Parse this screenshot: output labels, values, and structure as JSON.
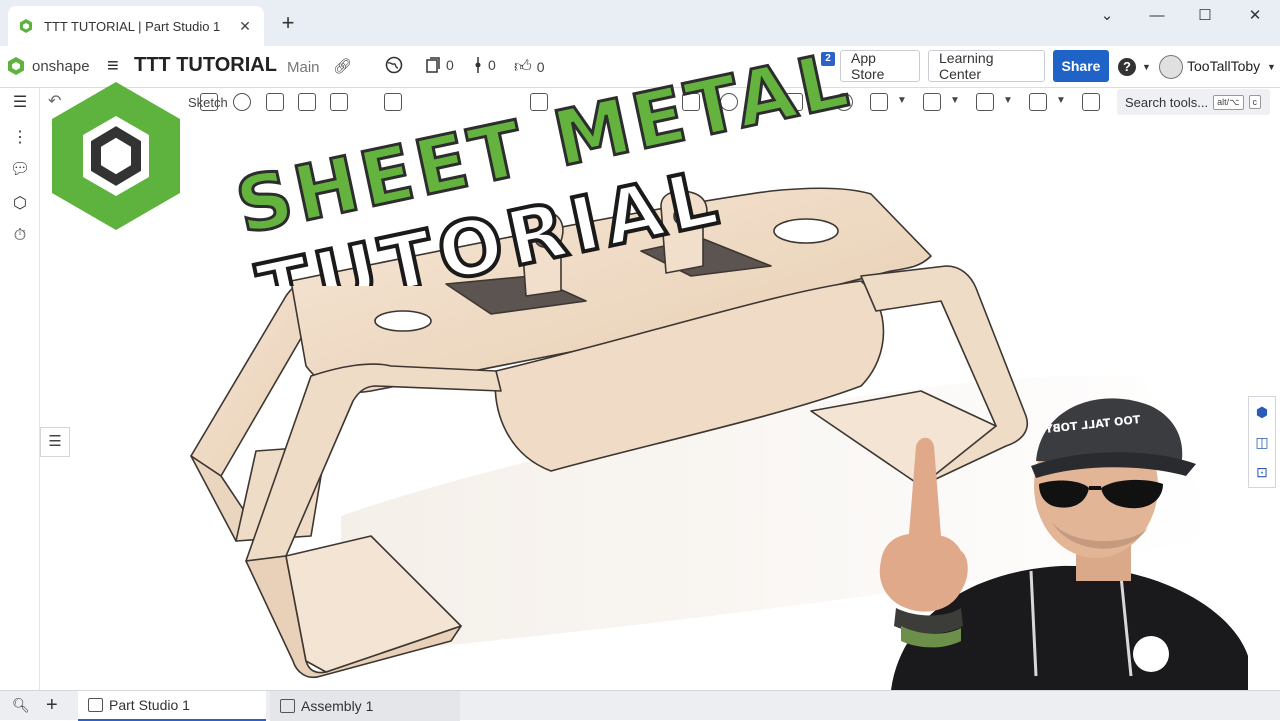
{
  "browser": {
    "tab_title": "TTT TUTORIAL | Part Studio 1",
    "new_tab": "+",
    "close": "✕",
    "window_controls": [
      "⌄",
      "—",
      "☐",
      "✕"
    ]
  },
  "header": {
    "brand": "onshape",
    "menu": "≡",
    "document_title": "TTT TUTORIAL",
    "branch": "Main",
    "versions_count": "0",
    "branches_count": "0",
    "likes_count": "0",
    "notification_count": "2",
    "app_store": "App Store",
    "learning_center": "Learning Center",
    "share": "Share",
    "help": "?",
    "user": "TooTallToby"
  },
  "toolbar": {
    "sketch_label": "Sketch",
    "search_placeholder": "Search tools...",
    "shortcut_1": "alt/⌥",
    "shortcut_2": "c"
  },
  "overlay": {
    "line1": "SHEET METAL",
    "line2": "TUTORIAL",
    "hat_text": "TOO TALL TOBY"
  },
  "bottom_tabs": {
    "add": "+",
    "tab1": "Part Studio 1",
    "tab2": "Assembly 1"
  },
  "colors": {
    "accent_blue": "#1f63c8",
    "onshape_green": "#5db33d",
    "sheet_metal_part": "#f1dfcb"
  }
}
